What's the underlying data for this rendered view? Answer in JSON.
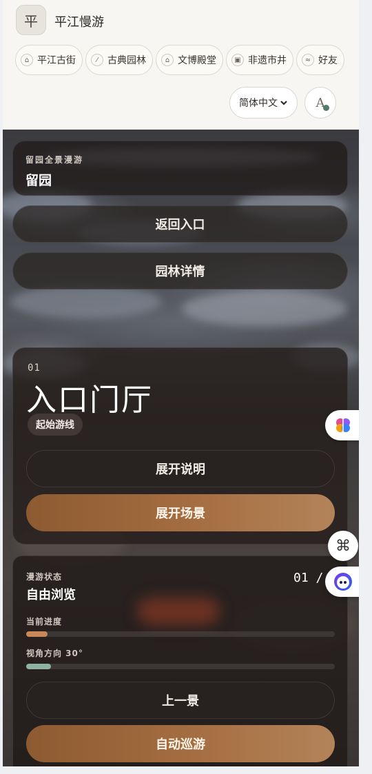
{
  "app": {
    "logo_char": "平",
    "title": "平江慢游"
  },
  "nav_chips": [
    {
      "label": "平江古街",
      "icon": "home-icon",
      "glyph": "⌂"
    },
    {
      "label": "古典园林",
      "icon": "leaf-icon",
      "glyph": "⁄"
    },
    {
      "label": "文博殿堂",
      "icon": "museum-icon",
      "glyph": "⌂"
    },
    {
      "label": "非遗市井",
      "icon": "lock-icon",
      "glyph": "▣"
    },
    {
      "label": "好友",
      "icon": "wave-icon",
      "glyph": "≈"
    }
  ],
  "language": {
    "selected": "简体中文",
    "icon": "chevron-down-icon"
  },
  "font_button": {
    "letter": "A",
    "icon": "font-size-icon",
    "accent": "#547a6d"
  },
  "tour": {
    "overline": "留园全景漫游",
    "garden_name": "留园",
    "back_label": "返回入口",
    "details_label": "园林详情"
  },
  "scene": {
    "number": "01",
    "title": "入口门厅",
    "tag": "起始游线",
    "explain_label": "展开说明",
    "expand_label": "展开场景"
  },
  "status": {
    "overline": "漫游状态",
    "mode": "自由浏览",
    "counter": "01 /",
    "progress_label": "当前进度",
    "progress_value": 0.07,
    "progress_color": "#c9875a",
    "view_label": "视角方向 30°",
    "view_value": 0.08,
    "view_color": "#8fb3a3",
    "prev_label": "上一景",
    "auto_label": "自动巡游"
  },
  "fabs": {
    "brain": "brain-icon",
    "grid": "command-icon",
    "assistant": "assistant-icon",
    "grid_glyph": "⌘"
  }
}
